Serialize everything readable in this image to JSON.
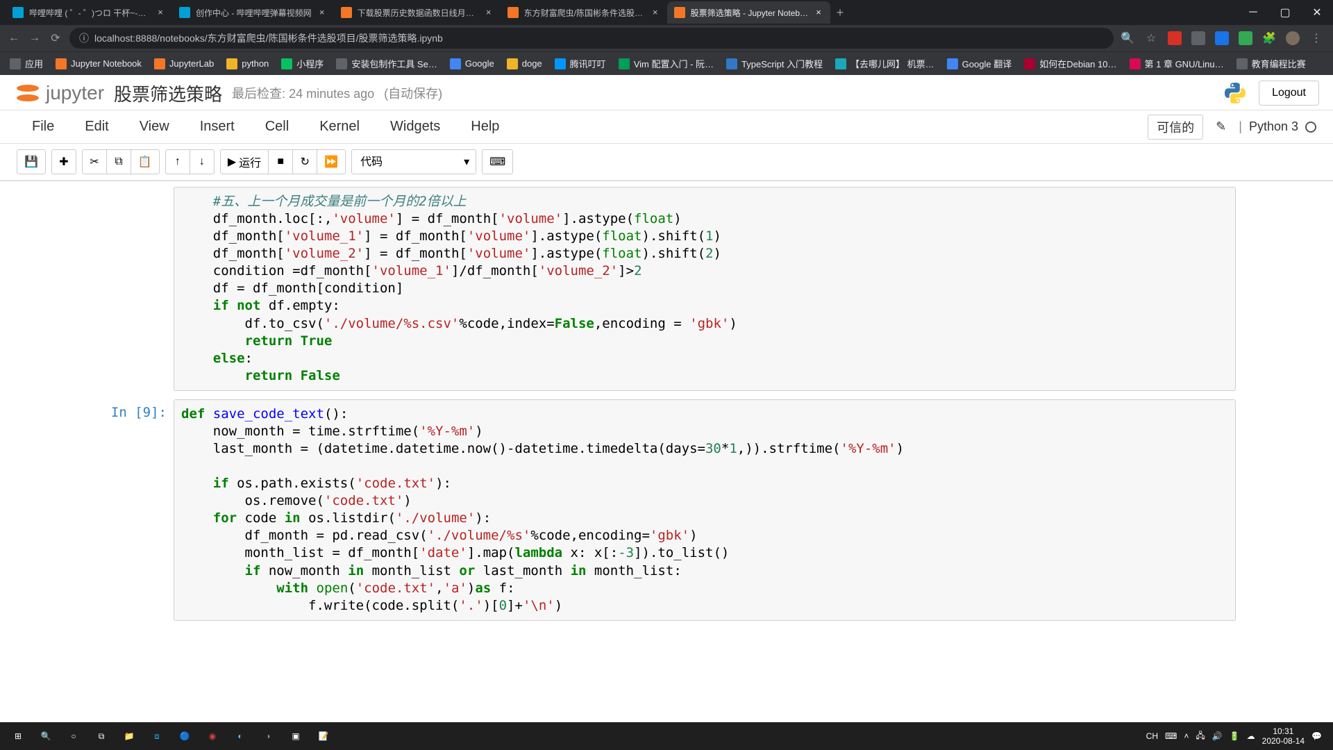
{
  "browser": {
    "tabs": [
      {
        "title": "哔哩哔哩 ( ゜- ゜)つロ 干杯~-bil…",
        "favicon_bg": "#00a1d6"
      },
      {
        "title": "创作中心 - 哔哩哔哩弹幕视频网",
        "favicon_bg": "#00a1d6"
      },
      {
        "title": "下载股票历史数据函数日线月线…",
        "favicon_bg": "#f37726"
      },
      {
        "title": "东方财富爬虫/陈国彬条件选股项…",
        "favicon_bg": "#f37726"
      },
      {
        "title": "股票筛选策略 - Jupyter Noteb…",
        "favicon_bg": "#f37726",
        "active": true
      }
    ],
    "url": "localhost:8888/notebooks/东方财富爬虫/陈国彬条件选股项目/股票筛选策略.ipynb",
    "bookmarks": [
      {
        "label": "应用",
        "color": "#5f6368"
      },
      {
        "label": "Jupyter Notebook",
        "color": "#f37726"
      },
      {
        "label": "JupyterLab",
        "color": "#f37726"
      },
      {
        "label": "python",
        "color": "#f0b429"
      },
      {
        "label": "小程序",
        "color": "#07c160"
      },
      {
        "label": "安装包制作工具 Se…",
        "color": "#5f6368"
      },
      {
        "label": "Google",
        "color": "#4285f4"
      },
      {
        "label": "doge",
        "color": "#f0b429"
      },
      {
        "label": "腾讯叮叮",
        "color": "#0098ff"
      },
      {
        "label": "Vim 配置入门 - 阮…",
        "color": "#019e59"
      },
      {
        "label": "TypeScript 入门教程",
        "color": "#3178c6"
      },
      {
        "label": "【去哪儿网】 机票…",
        "color": "#1ba9ba"
      },
      {
        "label": "Google 翻译",
        "color": "#4285f4"
      },
      {
        "label": "如何在Debian 10…",
        "color": "#a80030"
      },
      {
        "label": "第 1 章 GNU/Linu…",
        "color": "#d70a53"
      },
      {
        "label": "教育编程比赛",
        "color": "#5f6368"
      }
    ]
  },
  "jupyter": {
    "logo_text": "jupyter",
    "notebook_name": "股票筛选策略",
    "checkpoint": "最后检查: 24 minutes ago",
    "autosave": "(自动保存)",
    "logout": "Logout",
    "trusted": "可信的",
    "kernel": "Python 3",
    "menu": [
      "File",
      "Edit",
      "View",
      "Insert",
      "Cell",
      "Kernel",
      "Widgets",
      "Help"
    ],
    "run_label": "运行",
    "cell_type": "代码"
  },
  "cells": [
    {
      "prompt": "",
      "tokens": [
        {
          "t": "    ",
          "c": ""
        },
        {
          "t": "#五、上一个月成交量是前一个月的2倍以上",
          "c": "cm-comment"
        },
        {
          "t": "\n",
          "c": ""
        },
        {
          "t": "    df_month.loc[:,",
          "c": ""
        },
        {
          "t": "'volume'",
          "c": "cm-string"
        },
        {
          "t": "] = df_month[",
          "c": ""
        },
        {
          "t": "'volume'",
          "c": "cm-string"
        },
        {
          "t": "].astype(",
          "c": ""
        },
        {
          "t": "float",
          "c": "cm-builtin"
        },
        {
          "t": ")\n",
          "c": ""
        },
        {
          "t": "    df_month[",
          "c": ""
        },
        {
          "t": "'volume_1'",
          "c": "cm-string"
        },
        {
          "t": "] = df_month[",
          "c": ""
        },
        {
          "t": "'volume'",
          "c": "cm-string"
        },
        {
          "t": "].astype(",
          "c": ""
        },
        {
          "t": "float",
          "c": "cm-builtin"
        },
        {
          "t": ").shift(",
          "c": ""
        },
        {
          "t": "1",
          "c": "cm-number"
        },
        {
          "t": ")\n",
          "c": ""
        },
        {
          "t": "    df_month[",
          "c": ""
        },
        {
          "t": "'volume_2'",
          "c": "cm-string"
        },
        {
          "t": "] = df_month[",
          "c": ""
        },
        {
          "t": "'volume'",
          "c": "cm-string"
        },
        {
          "t": "].astype(",
          "c": ""
        },
        {
          "t": "float",
          "c": "cm-builtin"
        },
        {
          "t": ").shift(",
          "c": ""
        },
        {
          "t": "2",
          "c": "cm-number"
        },
        {
          "t": ")\n",
          "c": ""
        },
        {
          "t": "    condition =df_month[",
          "c": ""
        },
        {
          "t": "'volume_1'",
          "c": "cm-string"
        },
        {
          "t": "]/df_month[",
          "c": ""
        },
        {
          "t": "'volume_2'",
          "c": "cm-string"
        },
        {
          "t": "]>",
          "c": ""
        },
        {
          "t": "2",
          "c": "cm-number"
        },
        {
          "t": "\n",
          "c": ""
        },
        {
          "t": "    df = df_month[condition]\n",
          "c": ""
        },
        {
          "t": "    ",
          "c": ""
        },
        {
          "t": "if",
          "c": "cm-keyword"
        },
        {
          "t": " ",
          "c": ""
        },
        {
          "t": "not",
          "c": "cm-keyword"
        },
        {
          "t": " df.empty:\n",
          "c": ""
        },
        {
          "t": "        df.to_csv(",
          "c": ""
        },
        {
          "t": "'./volume/%s.csv'",
          "c": "cm-string"
        },
        {
          "t": "%code,index=",
          "c": ""
        },
        {
          "t": "False",
          "c": "cm-keyword"
        },
        {
          "t": ",encoding = ",
          "c": ""
        },
        {
          "t": "'gbk'",
          "c": "cm-string"
        },
        {
          "t": ")\n",
          "c": ""
        },
        {
          "t": "        ",
          "c": ""
        },
        {
          "t": "return",
          "c": "cm-keyword"
        },
        {
          "t": " ",
          "c": ""
        },
        {
          "t": "True",
          "c": "cm-keyword"
        },
        {
          "t": "\n",
          "c": ""
        },
        {
          "t": "    ",
          "c": ""
        },
        {
          "t": "else",
          "c": "cm-keyword"
        },
        {
          "t": ":\n",
          "c": ""
        },
        {
          "t": "        ",
          "c": ""
        },
        {
          "t": "return",
          "c": "cm-keyword"
        },
        {
          "t": " ",
          "c": ""
        },
        {
          "t": "False",
          "c": "cm-keyword"
        }
      ]
    },
    {
      "prompt": "In  [9]:",
      "tokens": [
        {
          "t": "def",
          "c": "cm-keyword"
        },
        {
          "t": " ",
          "c": ""
        },
        {
          "t": "save_code_text",
          "c": "cm-def"
        },
        {
          "t": "():\n",
          "c": ""
        },
        {
          "t": "    now_month = time.strftime(",
          "c": ""
        },
        {
          "t": "'%Y-%m'",
          "c": "cm-string"
        },
        {
          "t": ")\n",
          "c": ""
        },
        {
          "t": "    last_month = (datetime.datetime.now()-datetime.timedelta(days=",
          "c": ""
        },
        {
          "t": "30",
          "c": "cm-number"
        },
        {
          "t": "*",
          "c": ""
        },
        {
          "t": "1",
          "c": "cm-number"
        },
        {
          "t": ",)).strftime(",
          "c": ""
        },
        {
          "t": "'%Y-%m'",
          "c": "cm-string"
        },
        {
          "t": ")\n",
          "c": ""
        },
        {
          "t": "\n",
          "c": ""
        },
        {
          "t": "    ",
          "c": ""
        },
        {
          "t": "if",
          "c": "cm-keyword"
        },
        {
          "t": " os.path.exists(",
          "c": ""
        },
        {
          "t": "'code.txt'",
          "c": "cm-string"
        },
        {
          "t": "):\n",
          "c": ""
        },
        {
          "t": "        os.remove(",
          "c": ""
        },
        {
          "t": "'code.txt'",
          "c": "cm-string"
        },
        {
          "t": ")\n",
          "c": ""
        },
        {
          "t": "    ",
          "c": ""
        },
        {
          "t": "for",
          "c": "cm-keyword"
        },
        {
          "t": " code ",
          "c": ""
        },
        {
          "t": "in",
          "c": "cm-keyword"
        },
        {
          "t": " os.listdir(",
          "c": ""
        },
        {
          "t": "'./volume'",
          "c": "cm-string"
        },
        {
          "t": "):\n",
          "c": ""
        },
        {
          "t": "        df_month = pd.read_csv(",
          "c": ""
        },
        {
          "t": "'./volume/%s'",
          "c": "cm-string"
        },
        {
          "t": "%code,encoding=",
          "c": ""
        },
        {
          "t": "'gbk'",
          "c": "cm-string"
        },
        {
          "t": ")\n",
          "c": ""
        },
        {
          "t": "        month_list = df_month[",
          "c": ""
        },
        {
          "t": "'date'",
          "c": "cm-string"
        },
        {
          "t": "].map(",
          "c": ""
        },
        {
          "t": "lambda",
          "c": "cm-keyword"
        },
        {
          "t": " x: x[:",
          "c": ""
        },
        {
          "t": "-3",
          "c": "cm-number"
        },
        {
          "t": "]).to_list()\n",
          "c": ""
        },
        {
          "t": "        ",
          "c": ""
        },
        {
          "t": "if",
          "c": "cm-keyword"
        },
        {
          "t": " now_month ",
          "c": ""
        },
        {
          "t": "in",
          "c": "cm-keyword"
        },
        {
          "t": " month_list ",
          "c": ""
        },
        {
          "t": "or",
          "c": "cm-keyword"
        },
        {
          "t": " last_month ",
          "c": ""
        },
        {
          "t": "in",
          "c": "cm-keyword"
        },
        {
          "t": " month_list:\n",
          "c": ""
        },
        {
          "t": "            ",
          "c": ""
        },
        {
          "t": "with",
          "c": "cm-keyword"
        },
        {
          "t": " ",
          "c": ""
        },
        {
          "t": "open",
          "c": "cm-builtin"
        },
        {
          "t": "(",
          "c": ""
        },
        {
          "t": "'code.txt'",
          "c": "cm-string"
        },
        {
          "t": ",",
          "c": ""
        },
        {
          "t": "'a'",
          "c": "cm-string"
        },
        {
          "t": ")",
          "c": ""
        },
        {
          "t": "as",
          "c": "cm-keyword"
        },
        {
          "t": " f:\n",
          "c": ""
        },
        {
          "t": "                f.write(code.split(",
          "c": ""
        },
        {
          "t": "'.'",
          "c": "cm-string"
        },
        {
          "t": ")[",
          "c": ""
        },
        {
          "t": "0",
          "c": "cm-number"
        },
        {
          "t": "]+",
          "c": ""
        },
        {
          "t": "'\\n'",
          "c": "cm-string"
        },
        {
          "t": ")",
          "c": ""
        }
      ]
    }
  ],
  "taskbar": {
    "ime": "CH",
    "time": "10:31",
    "date": "2020-08-14"
  }
}
